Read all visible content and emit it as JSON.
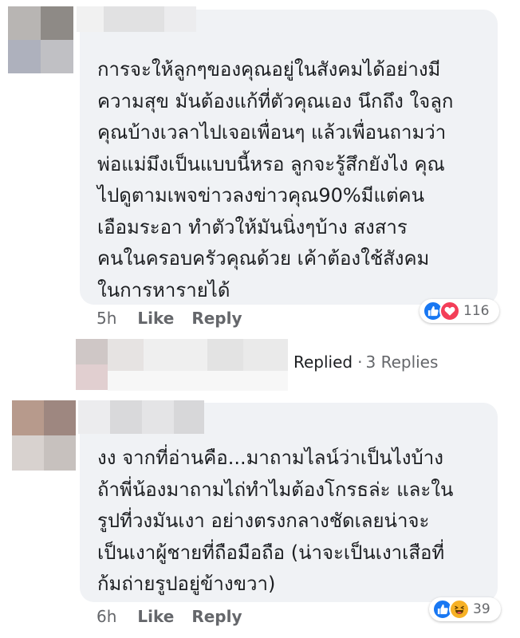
{
  "comments": [
    {
      "lines": [
        "การจะให้ลูกๆของคุณอยู่ในสังคมได้อย่างมี",
        "ความสุข มันต้องแก้ที่ตัวคุณเอง นึกถึง ใจลูก",
        "คุณบ้างเวลาไปเจอเพื่อนๆ แล้วเพื่อนถามว่า",
        "พ่อแม่มึงเป็นแบบนี้หรอ ลูกจะรู้สึกยังไง คุณ",
        "ไปดูตามเพจข่าวลงข่าวคุณ90%มีแต่คน",
        "เอือมระอา ทำตัวให้มันนิ่งๆบ้าง สงสาร",
        "คนในครอบครัวคุณด้วย เค้าต้องใช้สังคม",
        "ในการหารายได้"
      ],
      "time": "5h",
      "like_label": "Like",
      "reply_label": "Reply",
      "reaction_count": "116",
      "reactions": [
        "like-icon",
        "love-icon"
      ]
    },
    {
      "lines": [
        "งง จากที่อ่านคือ...มาถามไลน์ว่าเป็นไงบ้าง",
        "ถ้าพี่น้องมาถามไถ่ทำไมต้องโกรธล่ะ และใน",
        "รูปที่วงมันเงา อย่างตรงกลางชัดเลยน่าจะ",
        "เป็นเงาผู้ชายที่ถือมือถือ (น่าจะเป็นเงาเสือที่",
        "ก้มถ่ายรูปอยู่ข้างขวา)"
      ],
      "time": "6h",
      "like_label": "Like",
      "reply_label": "Reply",
      "reaction_count": "39",
      "reactions": [
        "like-icon",
        "haha-icon"
      ]
    }
  ],
  "reply_thread": {
    "replied_label": "Replied",
    "separator": "·",
    "replies_label": "3 Replies"
  },
  "colors": {
    "bubble": "#f0f2f5",
    "meta_text": "#65676b",
    "like_blue": "#1877f2",
    "love_red": "#f33e58",
    "haha_yellow": "#f7b125"
  }
}
